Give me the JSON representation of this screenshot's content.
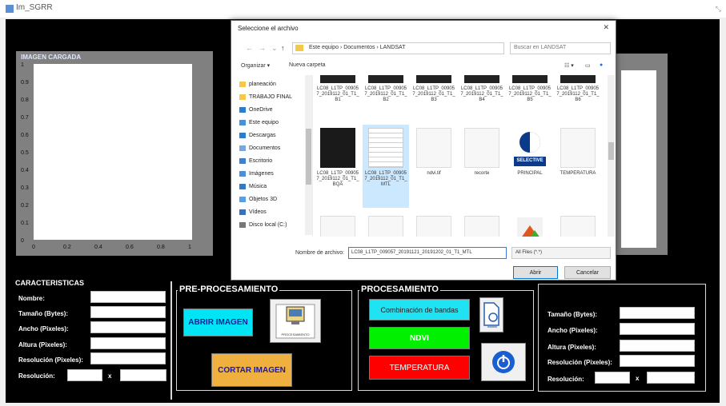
{
  "window": {
    "title": "Im_SGRR"
  },
  "plot": {
    "title": "IMAGEN CARGADA",
    "yticks": [
      "1",
      "0.9",
      "0.8",
      "0.7",
      "0.6",
      "0.5",
      "0.4",
      "0.3",
      "0.2",
      "0.1",
      "0"
    ],
    "xticks": [
      "0",
      "0.2",
      "0.4",
      "0.6",
      "0.8",
      "1"
    ]
  },
  "characteristics": {
    "title": "CARACTERISTICAS",
    "fields": [
      {
        "label": "Nombre:",
        "value": ""
      },
      {
        "label": "Tamaño (Bytes):",
        "value": ""
      },
      {
        "label": "Ancho (Pixeles):",
        "value": ""
      },
      {
        "label": "Altura (Pixeles):",
        "value": ""
      },
      {
        "label": "Resolución (Pixeles):",
        "value": ""
      }
    ],
    "resolution_label": "Resolución:",
    "x_sep": "x"
  },
  "preprocessing": {
    "title": "PRE-PROCESAMIENTO",
    "open_label": "ABRIR IMAGEN",
    "crop_label": "CORTAR IMAGEN",
    "icon_caption": "PROCESAMIENTO"
  },
  "processing": {
    "title": "PROCESAMIENTO",
    "bands_label": "Combinación de bandas",
    "ndvi_label": "NDVI",
    "temp_label": "TEMPERATURA"
  },
  "results": {
    "fields": [
      {
        "label": "Tamaño (Bytes):",
        "value": ""
      },
      {
        "label": "Ancho (Pixeles):",
        "value": ""
      },
      {
        "label": "Altura (Pixeles):",
        "value": ""
      },
      {
        "label": "Resolución (Pixeles):",
        "value": ""
      }
    ],
    "resolution_label": "Resolución:",
    "x_sep": "x"
  },
  "dialog": {
    "title": "Seleccione el archivo",
    "address": "Este equipo › Documentos › LANDSAT",
    "search_placeholder": "Buscar en LANDSAT",
    "organize": "Organizar ▾",
    "new_folder": "Nueva carpeta",
    "nav_items": [
      {
        "label": "planeación",
        "icon": "folder-icon",
        "color": "#f2c94c"
      },
      {
        "label": "TRABAJO FINAL",
        "icon": "folder-icon",
        "color": "#f2c94c"
      },
      {
        "label": "OneDrive",
        "icon": "cloud-icon",
        "color": "#2b7cd3"
      },
      {
        "label": "Este equipo",
        "icon": "computer-icon",
        "color": "#4a90d9"
      },
      {
        "label": "Descargas",
        "icon": "download-icon",
        "color": "#2b7cd3"
      },
      {
        "label": "Documentos",
        "icon": "documents-icon",
        "color": "#7aa7d8"
      },
      {
        "label": "Escritorio",
        "icon": "desktop-icon",
        "color": "#3f7fd0"
      },
      {
        "label": "Imágenes",
        "icon": "pictures-icon",
        "color": "#4d8fd6"
      },
      {
        "label": "Música",
        "icon": "music-icon",
        "color": "#3a78c2"
      },
      {
        "label": "Objetos 3D",
        "icon": "objects3d-icon",
        "color": "#5aa0e0"
      },
      {
        "label": "Vídeos",
        "icon": "videos-icon",
        "color": "#3c6fb8"
      },
      {
        "label": "Disco local (C:)",
        "icon": "drive-icon",
        "color": "#777777"
      }
    ],
    "files": [
      {
        "caption": "LC08_L1TP_009057_2019112_01_T1_B1",
        "kind": "strip"
      },
      {
        "caption": "LC08_L1TP_009057_2019112_01_T1_B2",
        "kind": "strip"
      },
      {
        "caption": "LC08_L1TP_009057_2019112_01_T1_B3",
        "kind": "strip"
      },
      {
        "caption": "LC08_L1TP_009057_2019112_01_T1_B4",
        "kind": "strip"
      },
      {
        "caption": "LC08_L1TP_009057_2019112_01_T1_B5",
        "kind": "strip"
      },
      {
        "caption": "LC08_L1TP_009057_2019112_01_T1_B6",
        "kind": "strip"
      },
      {
        "caption": "LC08_L1TP_009057_2019112_01_T1_BQA",
        "kind": "dark"
      },
      {
        "caption": "LC08_L1TP_009057_2019112_01_T1_MTL",
        "kind": "lines",
        "selected": true
      },
      {
        "caption": "ndvi.tif",
        "kind": "doc"
      },
      {
        "caption": "recorte",
        "kind": "doc"
      },
      {
        "caption": "PRINCIPAL",
        "kind": "app"
      },
      {
        "caption": "TEMPERATURA",
        "kind": "doc"
      },
      {
        "caption": "",
        "kind": "doc"
      },
      {
        "caption": "",
        "kind": "doc"
      },
      {
        "caption": "",
        "kind": "doc"
      },
      {
        "caption": "",
        "kind": "doc"
      },
      {
        "caption": "",
        "kind": "photo"
      },
      {
        "caption": "",
        "kind": "doc"
      }
    ],
    "app_badge": "SELECTIVE",
    "filename_label": "Nombre de archivo:",
    "filename_value": "LC08_L1TP_009057_20191121_20191202_01_T1_MTL",
    "filetype_value": "All Files (*.*)",
    "open_btn": "Abrir",
    "cancel_btn": "Cancelar",
    "close": "✕"
  }
}
